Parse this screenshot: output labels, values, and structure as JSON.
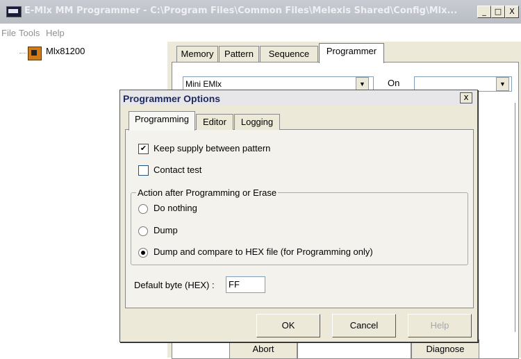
{
  "window": {
    "title": "E-Mlx MM Programmer - C:\\Program Files\\Common Files\\Melexis Shared\\Config\\Mlx...",
    "minimize": "_",
    "maximize": "□",
    "close": "X"
  },
  "menu": [
    "File",
    "Tools",
    "Help"
  ],
  "tree": {
    "items": [
      {
        "label": "Mlx81200",
        "icon": "chip-icon"
      }
    ]
  },
  "main_tabs": [
    {
      "label": "Memory",
      "active": false
    },
    {
      "label": "Pattern",
      "active": false
    },
    {
      "label": "Sequence",
      "active": false
    },
    {
      "label": "Programmer",
      "active": true
    }
  ],
  "programmer_panel": {
    "device_combo_value": "Mini EMlx",
    "on_label": "On",
    "port_combo_value": "",
    "abort_label": "Abort",
    "diagnose_label": "Diagnose"
  },
  "dialog": {
    "title": "Programmer Options",
    "close": "x",
    "tabs": [
      {
        "label": "Programming",
        "active": true
      },
      {
        "label": "Editor",
        "active": false
      },
      {
        "label": "Logging",
        "active": false
      }
    ],
    "keep_supply": {
      "label": "Keep supply between pattern",
      "checked": true,
      "mark": "✔"
    },
    "contact_test": {
      "label": "Contact test",
      "checked": false
    },
    "action_group": {
      "label": "Action after Programming or Erase",
      "options": [
        {
          "label": "Do nothing",
          "selected": false
        },
        {
          "label": "Dump",
          "selected": false
        },
        {
          "label": "Dump and compare to HEX file (for Programming only)",
          "selected": true
        }
      ]
    },
    "default_byte": {
      "label": "Default byte (HEX) :",
      "value": "FF"
    },
    "buttons": {
      "ok": "OK",
      "cancel": "Cancel",
      "help": "Help"
    }
  },
  "colors": {
    "dialog_title_text": "#1f2a5c",
    "face": "#ece9d8",
    "disabled_text": "#a7a7a7"
  }
}
